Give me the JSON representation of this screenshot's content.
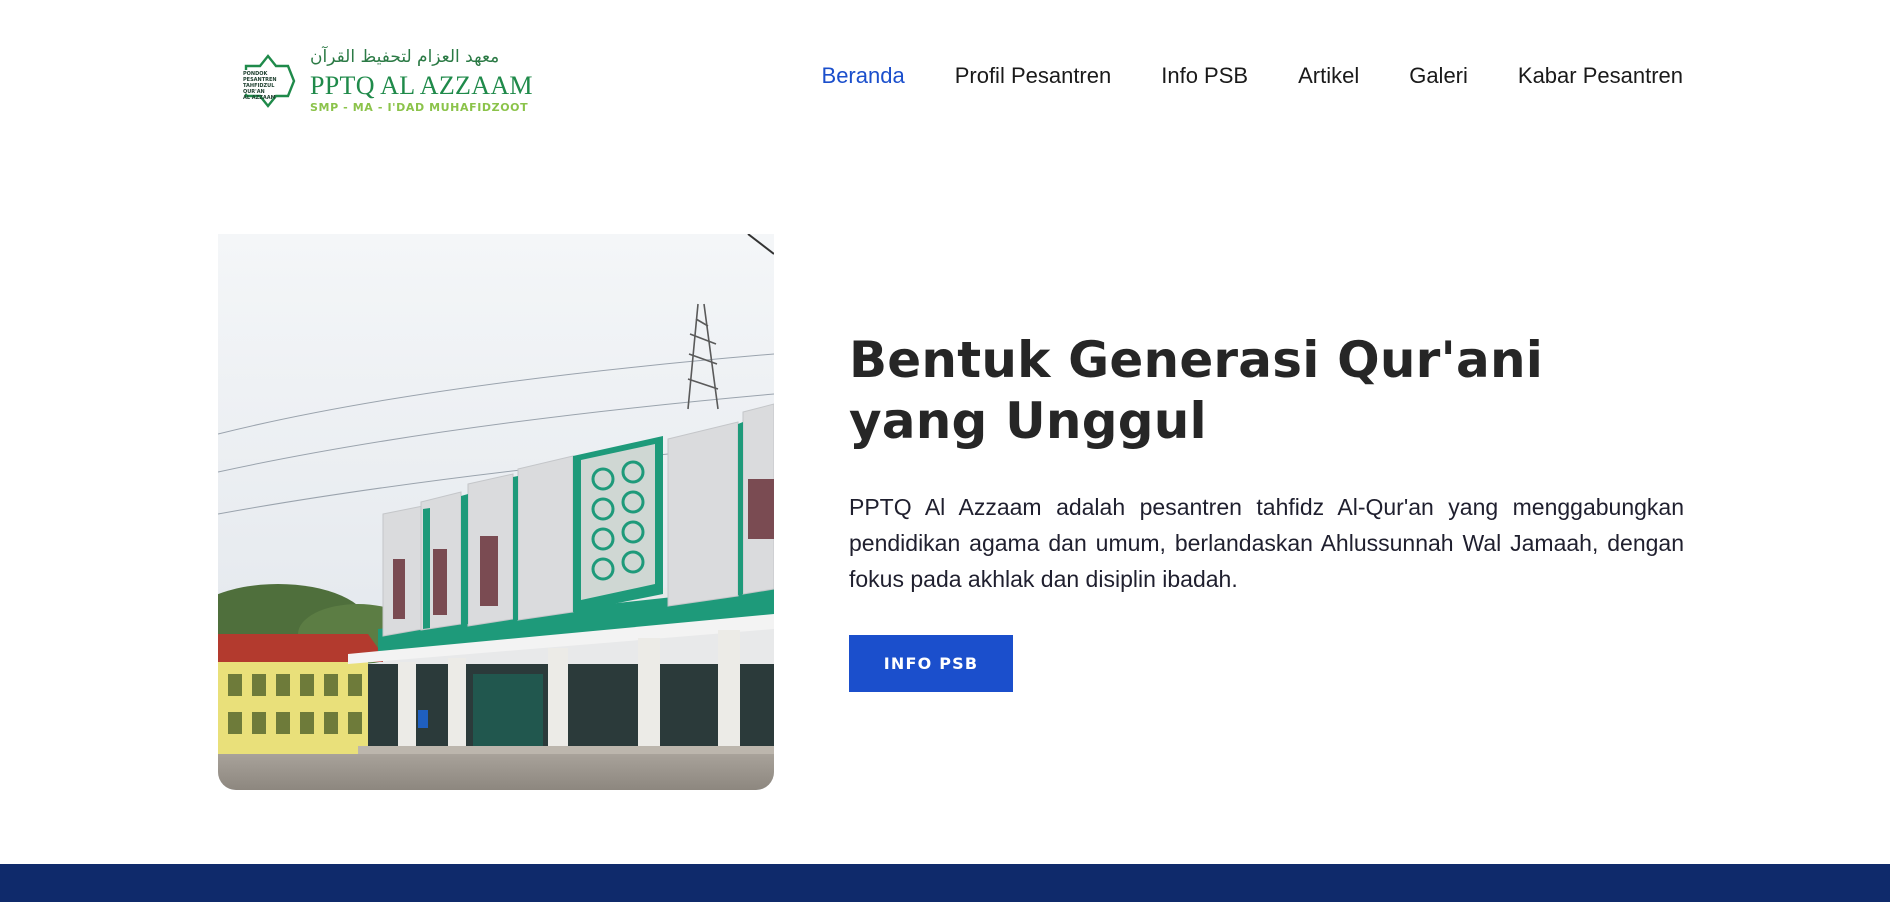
{
  "header": {
    "logo": {
      "seal_text": [
        "PONDOK",
        "PESANTREN",
        "TAHFIDZUL",
        "QUR'AN",
        "AL AZZAAM"
      ],
      "arabic": "معهد العزام لتحفيظ القرآن",
      "name": "PPTQ AL AZZAAM",
      "subtitle": "SMP - MA - I'DAD MUHAFIDZOOT"
    },
    "nav": [
      {
        "label": "Beranda",
        "active": true
      },
      {
        "label": "Profil Pesantren",
        "active": false
      },
      {
        "label": "Info PSB",
        "active": false
      },
      {
        "label": "Artikel",
        "active": false
      },
      {
        "label": "Galeri",
        "active": false
      },
      {
        "label": "Kabar Pesantren",
        "active": false
      }
    ]
  },
  "hero": {
    "title": "Bentuk Generasi Qur'ani yang Unggul",
    "description": "PPTQ Al Azzaam adalah pesantren tahfidz Al-Qur'an yang menggabungkan pendidikan agama dan umum, berlandaskan Ahlussunnah Wal Jamaah, dengan fokus pada akhlak dan disiplin ibadah.",
    "cta_label": "INFO PSB",
    "image_subject": "mosque-building-photo"
  },
  "colors": {
    "accent": "#1b4fcc",
    "nav_active": "#1b4fcc",
    "footer": "#0f2a6b",
    "logo_green": "#1f8a4a",
    "logo_lightgreen": "#8bc34a"
  }
}
